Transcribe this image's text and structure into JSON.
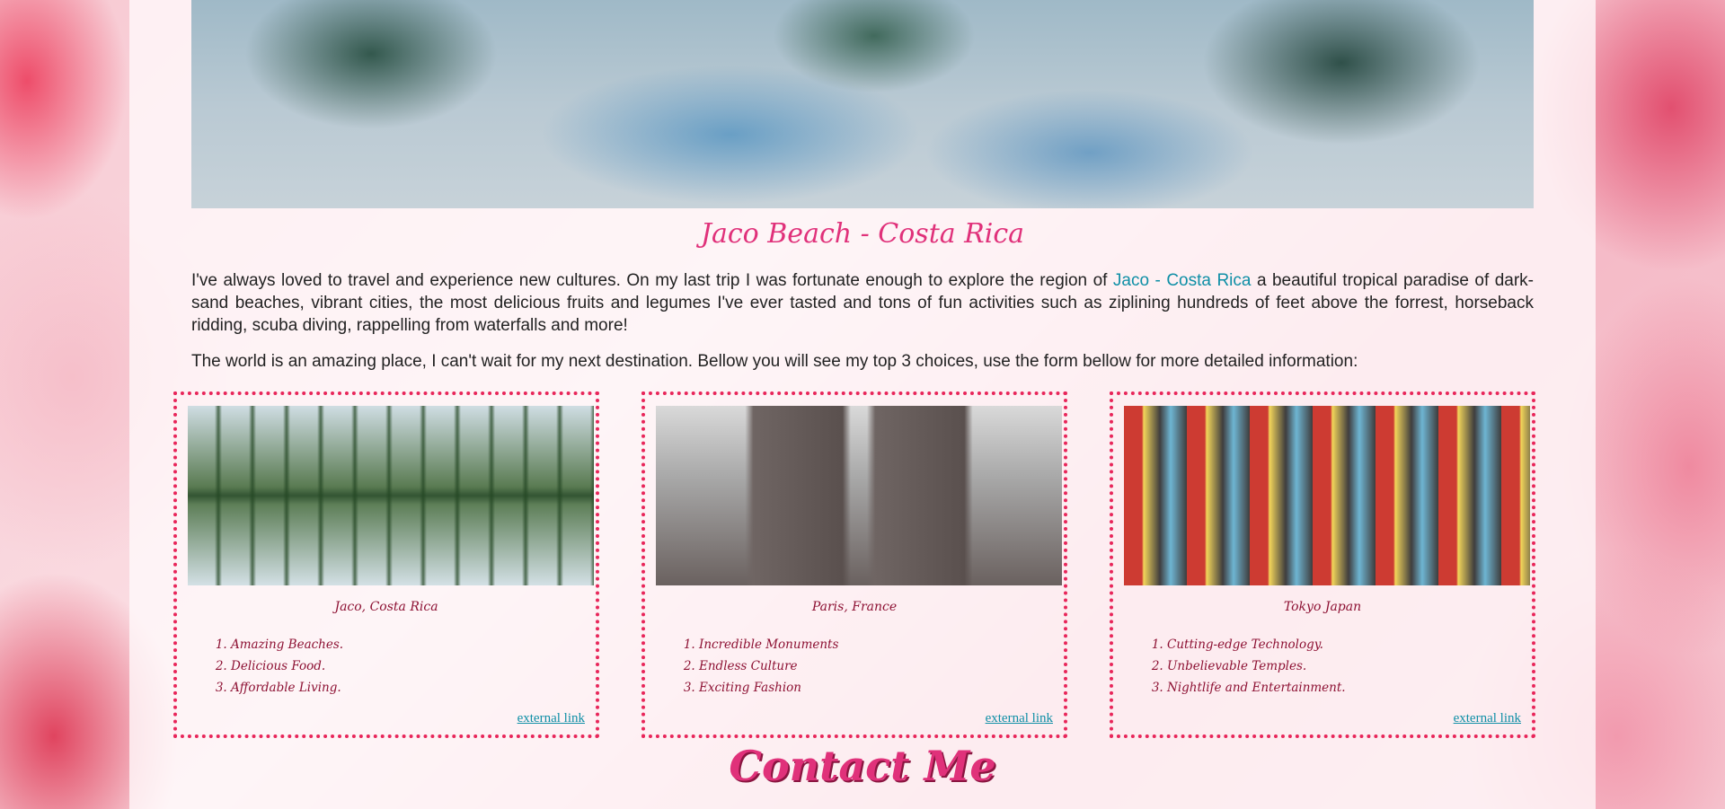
{
  "header": {
    "title": "Jaco Beach - Costa Rica"
  },
  "intro": {
    "p1_before": "I've always loved to travel and experience new cultures. On my last trip I was fortunate enough to explore the region of ",
    "p1_link": "Jaco - Costa Rica",
    "p1_after": " a beautiful tropical paradise of dark-sand beaches, vibrant cities, the most delicious fruits and legumes I've ever tasted and tons of fun activities such as ziplining hundreds of feet above the forrest, horseback ridding, scuba diving, rappelling from waterfalls and more!",
    "p2": "The world is an amazing place, I can't wait for my next destination. Bellow you will see my top 3 choices, use the form bellow for more detailed information:"
  },
  "destinations": [
    {
      "city": "Jaco, Costa Rica",
      "items": [
        "Amazing Beaches.",
        "Delicious Food.",
        "Affordable Living."
      ],
      "link_label": "external link"
    },
    {
      "city": "Paris, France",
      "items": [
        "Incredible Monuments",
        "Endless Culture",
        "Exciting Fashion"
      ],
      "link_label": "external link"
    },
    {
      "city": "Tokyo Japan",
      "items": [
        "Cutting-edge Technology.",
        "Unbelievable Temples.",
        "Nightlife and Entertainment."
      ],
      "link_label": "external link"
    }
  ],
  "contact": {
    "title": "Contact Me"
  },
  "colors": {
    "accent": "#e0317a",
    "card_border": "#e8265a",
    "link": "#0f8fa6",
    "card_text": "#8d1133"
  }
}
